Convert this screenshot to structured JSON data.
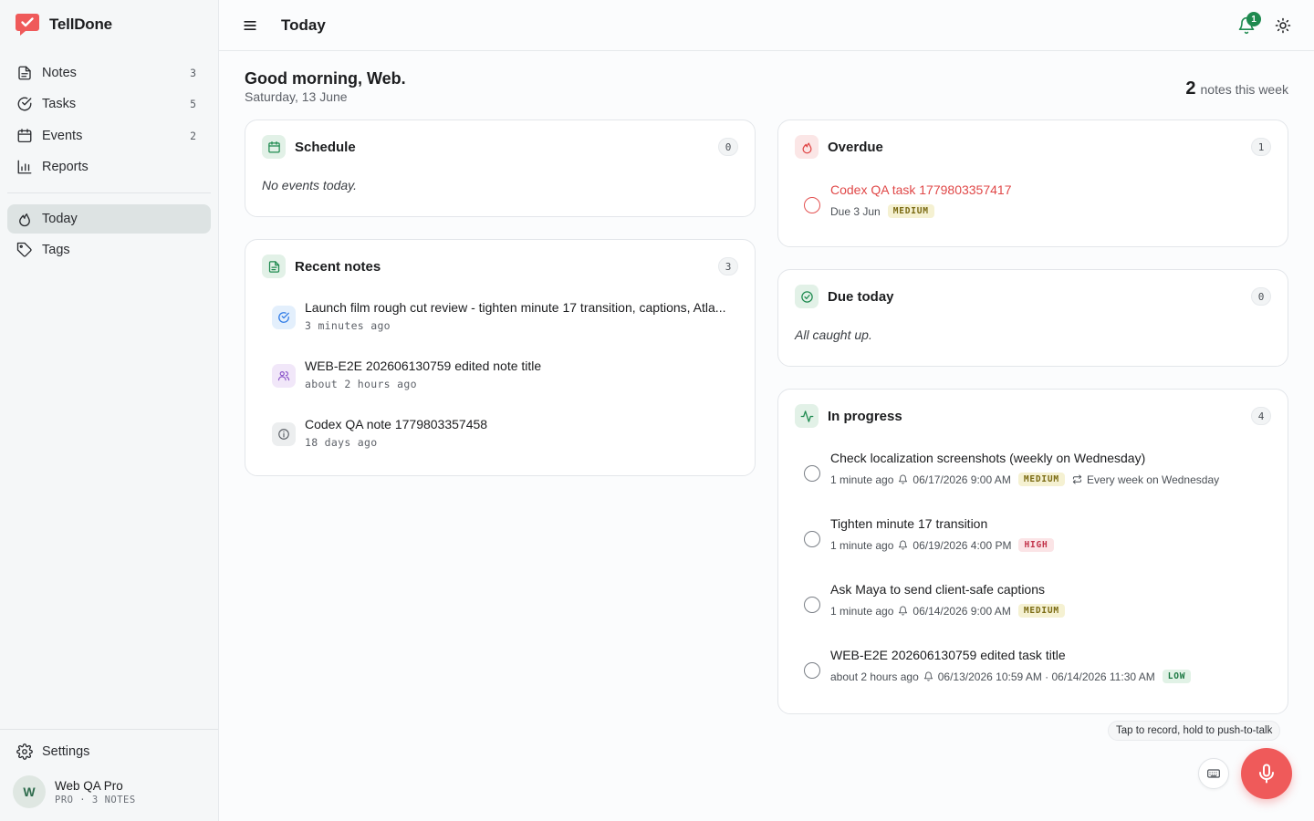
{
  "app": {
    "name": "TellDone"
  },
  "sidebar": {
    "items": [
      {
        "label": "Notes",
        "count": "3",
        "icon": "notes-icon"
      },
      {
        "label": "Tasks",
        "count": "5",
        "icon": "tasks-icon"
      },
      {
        "label": "Events",
        "count": "2",
        "icon": "calendar-icon"
      },
      {
        "label": "Reports",
        "count": "",
        "icon": "bar-chart-icon"
      }
    ],
    "secondary": [
      {
        "label": "Today",
        "icon": "flame-icon",
        "active": true
      },
      {
        "label": "Tags",
        "icon": "tag-icon"
      }
    ],
    "settings_label": "Settings",
    "user": {
      "initial": "W",
      "name": "Web QA Pro",
      "sub": "PRO · 3 NOTES"
    }
  },
  "header": {
    "title": "Today",
    "notification_count": "1"
  },
  "greeting": {
    "title": "Good morning, Web.",
    "date": "Saturday, 13 June",
    "week_count": "2",
    "week_label": "notes this week"
  },
  "schedule": {
    "title": "Schedule",
    "count": "0",
    "empty": "No events today."
  },
  "recent_notes": {
    "title": "Recent notes",
    "count": "3",
    "items": [
      {
        "title": "Launch film rough cut review - tighten minute 17 transition, captions, Atla...",
        "time": "3 minutes ago",
        "icon": "task-check-icon"
      },
      {
        "title": "WEB-E2E 202606130759 edited note title",
        "time": "about 2 hours ago",
        "icon": "people-icon"
      },
      {
        "title": "Codex QA note 1779803357458",
        "time": "18 days ago",
        "icon": "info-icon"
      }
    ]
  },
  "overdue": {
    "title": "Overdue",
    "count": "1",
    "items": [
      {
        "title": "Codex QA task 1779803357417",
        "due": "Due 3 Jun",
        "priority": "MEDIUM"
      }
    ]
  },
  "due_today": {
    "title": "Due today",
    "count": "0",
    "empty": "All caught up."
  },
  "in_progress": {
    "title": "In progress",
    "count": "4",
    "items": [
      {
        "title": "Check localization screenshots (weekly on Wednesday)",
        "time": "1 minute ago",
        "reminder": "06/17/2026 9:00 AM",
        "priority": "MEDIUM",
        "repeat": "Every week on Wednesday"
      },
      {
        "title": "Tighten minute 17 transition",
        "time": "1 minute ago",
        "reminder": "06/19/2026 4:00 PM",
        "priority": "HIGH"
      },
      {
        "title": "Ask Maya to send client-safe captions",
        "time": "1 minute ago",
        "reminder": "06/14/2026 9:00 AM",
        "priority": "MEDIUM"
      },
      {
        "title": "WEB-E2E 202606130759 edited task title",
        "time": "about 2 hours ago",
        "reminder": "06/13/2026 10:59 AM · 06/14/2026 11:30 AM",
        "priority": "LOW"
      }
    ]
  },
  "voice": {
    "tooltip": "Tap to record, hold to push-to-talk"
  },
  "colors": {
    "accent": "#1e8a4f",
    "danger": "#ef5a5a",
    "active_nav": "#dde3e3"
  }
}
